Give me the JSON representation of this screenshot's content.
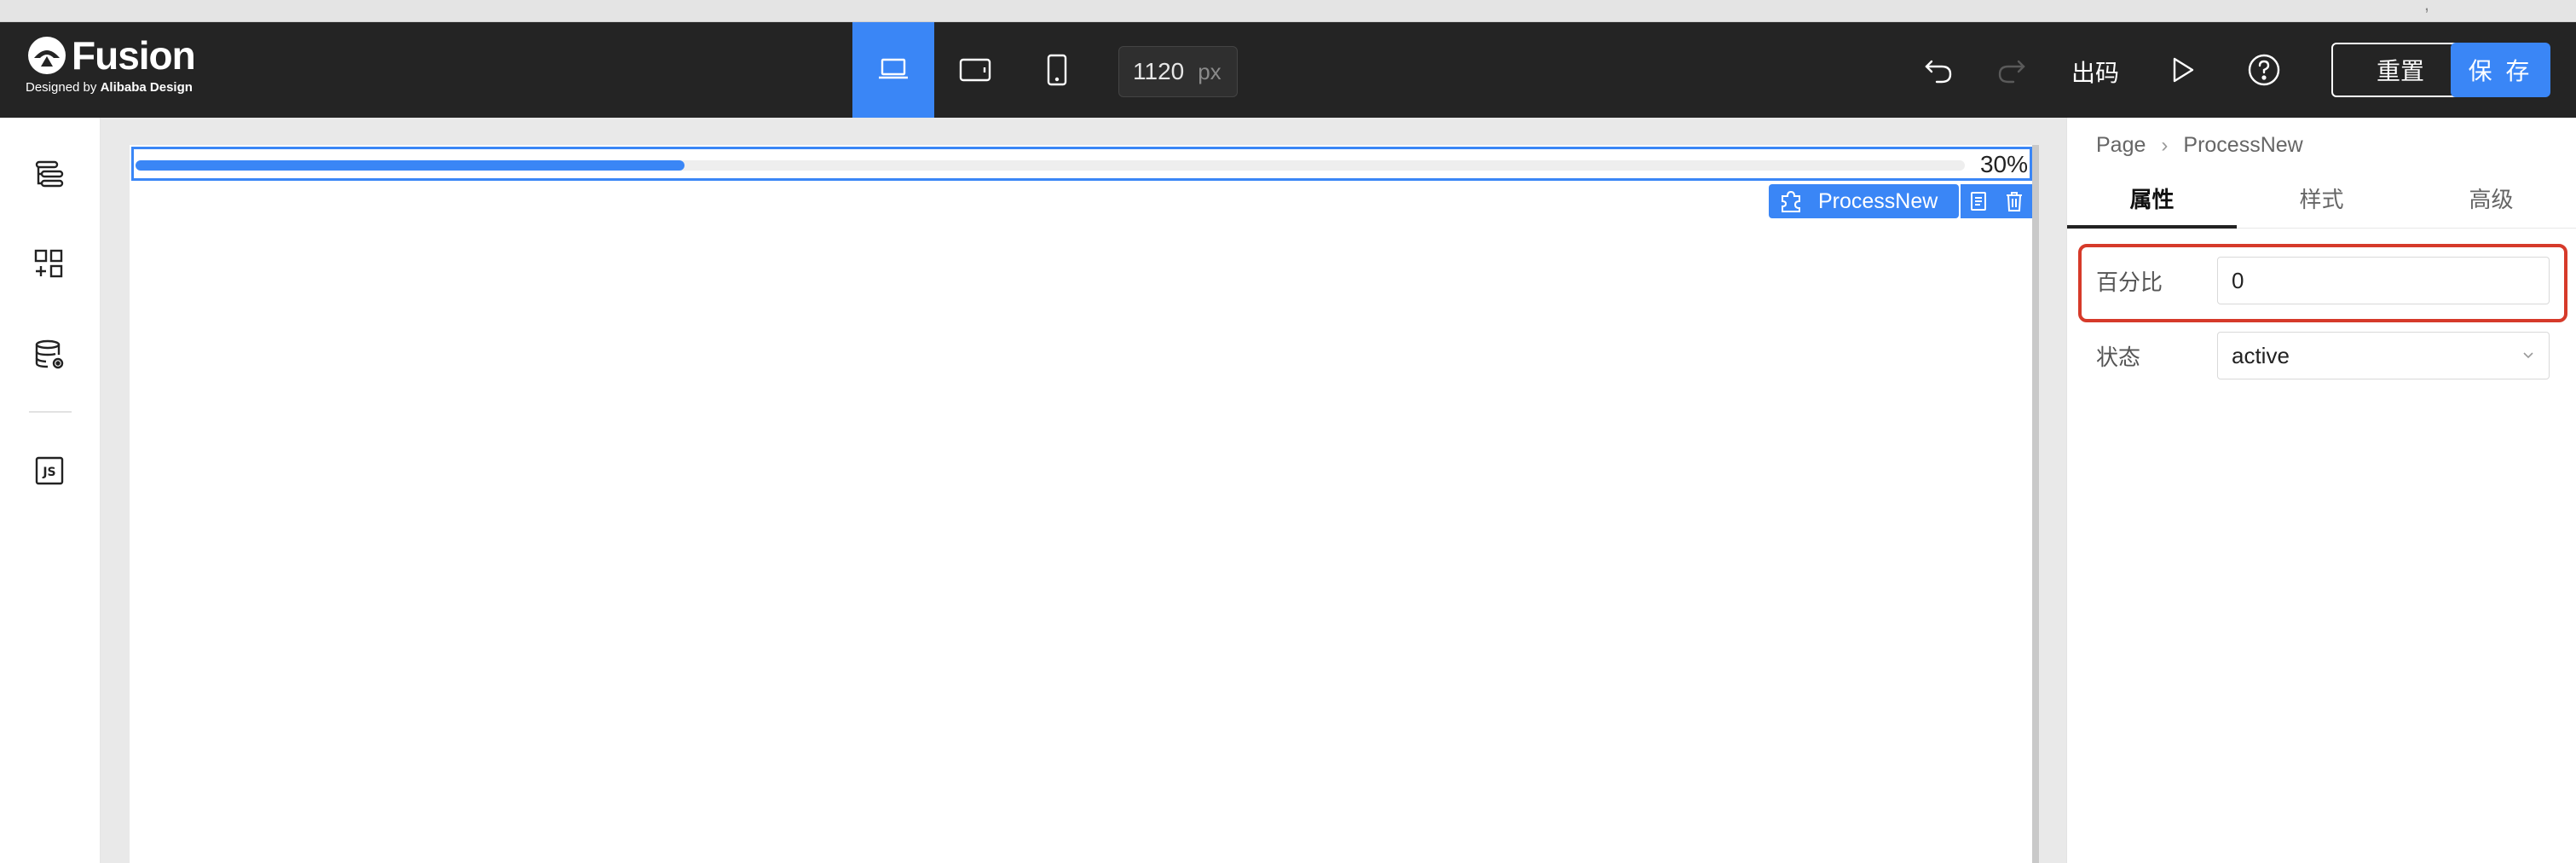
{
  "app": {
    "logo_text": "Fusion",
    "logo_sub_prefix": "Designed by",
    "logo_sub_brand": "Alibaba Design"
  },
  "toolbar": {
    "devices": [
      {
        "name": "desktop",
        "active": true
      },
      {
        "name": "tablet",
        "active": false
      },
      {
        "name": "phone",
        "active": false
      }
    ],
    "canvas_width_value": "1120",
    "canvas_width_unit": "px",
    "code_label": "出码",
    "reset_label": "重置",
    "save_label": "保 存"
  },
  "sidebar": {
    "items": [
      {
        "icon": "outline-tree-icon"
      },
      {
        "icon": "component-library-icon"
      },
      {
        "icon": "datasource-icon"
      },
      {
        "icon": "js-code-icon",
        "label": "JS"
      }
    ]
  },
  "canvas": {
    "progress_percent": 30,
    "progress_text": "30%",
    "selected_component": "ProcessNew",
    "accent_color": "#3a86f6"
  },
  "panel": {
    "breadcrumb": [
      "Page",
      "ProcessNew"
    ],
    "tabs": [
      "属性",
      "样式",
      "高级"
    ],
    "active_tab": 0,
    "fields": [
      {
        "label": "百分比",
        "value": "0"
      },
      {
        "label": "状态",
        "value": "active"
      }
    ],
    "highlight_color": "#d63a2a"
  }
}
